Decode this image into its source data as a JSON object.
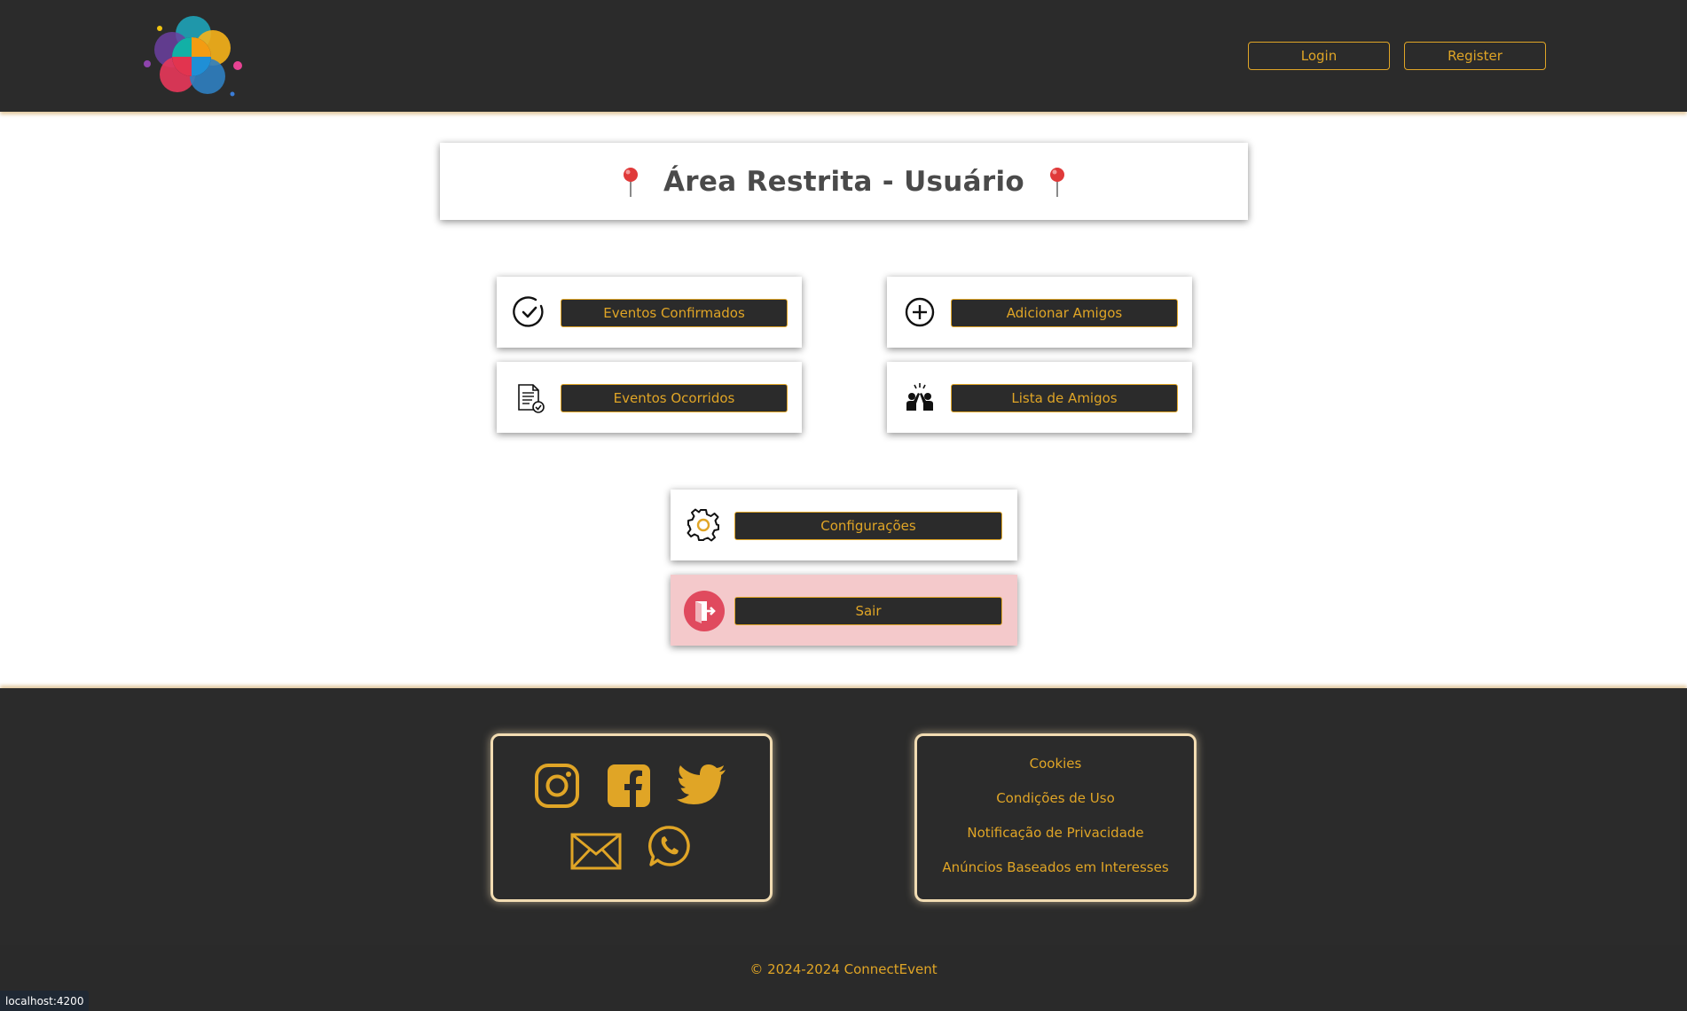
{
  "header": {
    "login_label": "Login",
    "register_label": "Register"
  },
  "page": {
    "title": "Área Restrita - Usuário"
  },
  "menu": {
    "confirmed_events": "Eventos Confirmados",
    "add_friends": "Adicionar Amigos",
    "past_events": "Eventos Ocorridos",
    "friends_list": "Lista de Amigos",
    "settings": "Configurações",
    "logout": "Sair"
  },
  "footer": {
    "social_icons": [
      "instagram-icon",
      "facebook-icon",
      "twitter-icon",
      "mail-icon",
      "whatsapp-icon"
    ],
    "links": [
      "Cookies",
      "Condições de Uso",
      "Notificação de Privacidade",
      "Anúncios Baseados em Interesses"
    ],
    "copyright": "© 2024-2024 ConnectEvent"
  },
  "status_bar": {
    "url": "localhost:4200"
  },
  "colors": {
    "dark": "#2b2b2b",
    "accent": "#e0a526",
    "exit_bg": "#f4c9cb",
    "pin": "#e03a3a"
  }
}
